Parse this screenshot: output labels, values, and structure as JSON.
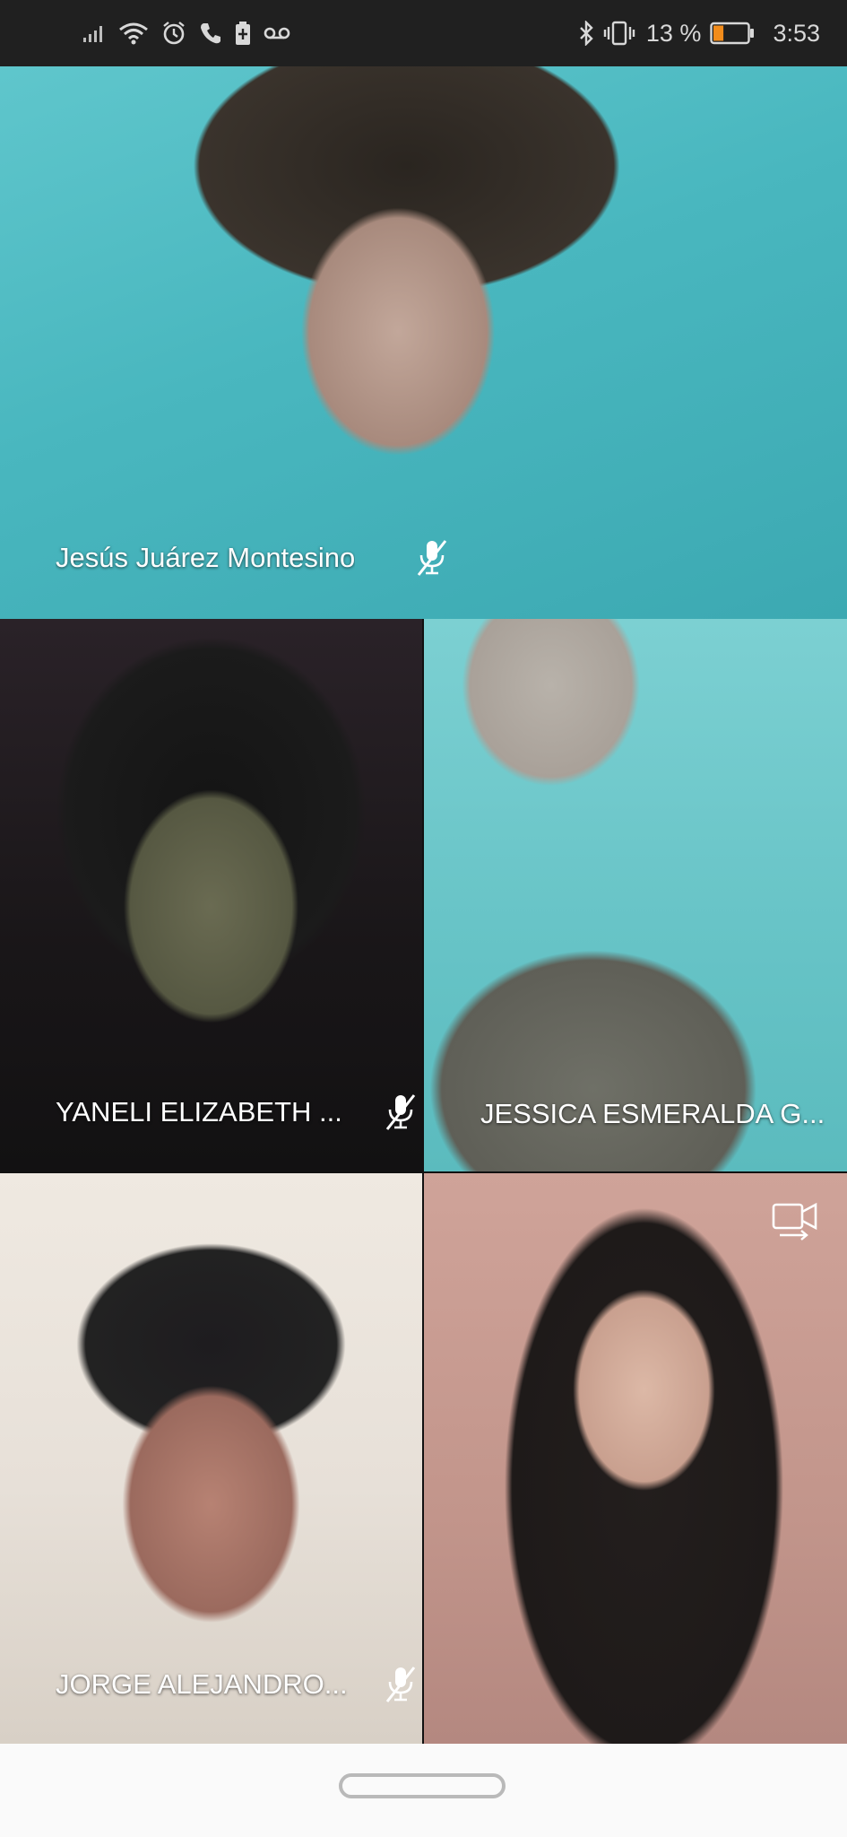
{
  "status_bar": {
    "left_icons": [
      "signal-icon",
      "wifi-icon",
      "alarm-icon",
      "phone-icon",
      "battery-saver-icon",
      "voicemail-icon"
    ],
    "right_icons": [
      "bluetooth-icon",
      "vibrate-icon",
      "battery-icon"
    ],
    "battery_percent_text": "13 %",
    "battery_level": 0.13,
    "time": "3:53"
  },
  "participants": [
    {
      "name": "Jesús Juárez Montesino",
      "muted": true
    },
    {
      "name": "YANELI ELIZABETH ...",
      "muted": true
    },
    {
      "name": "JESSICA ESMERALDA G...",
      "muted": false
    },
    {
      "name": "JORGE ALEJANDRO...",
      "muted": true
    }
  ],
  "self_view": {
    "switch_camera_icon": "switch-camera-icon"
  },
  "colors": {
    "label_text": "#ffffff",
    "status_bar_bg": "#202020",
    "nav_bar_bg": "#fafafa",
    "battery_low": "#f28c1b"
  }
}
